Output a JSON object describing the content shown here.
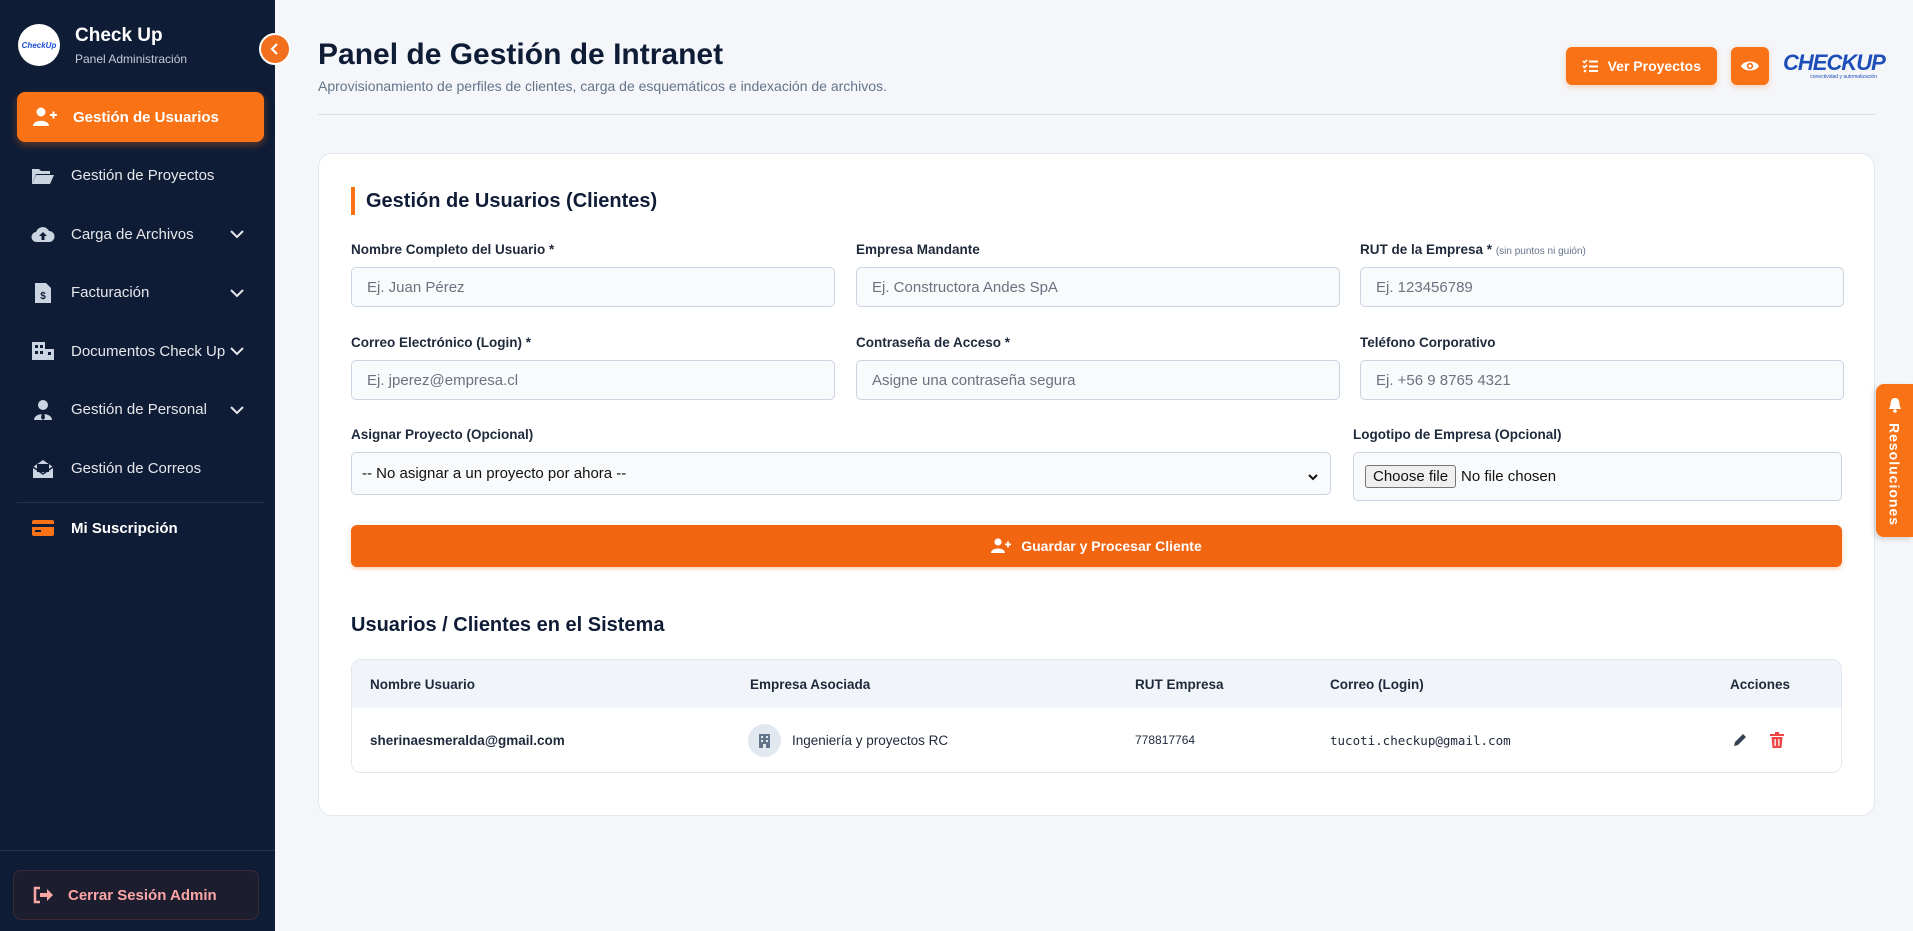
{
  "sidebar": {
    "brand_title": "Check Up",
    "brand_subtitle": "Panel Administración",
    "brand_logo_text": "CheckUp",
    "items": [
      {
        "label": "Gestión de Usuarios",
        "icon": "user-plus-icon",
        "active": true
      },
      {
        "label": "Gestión de Proyectos",
        "icon": "folder-open-icon"
      },
      {
        "label": "Carga de Archivos",
        "icon": "cloud-upload-icon",
        "expandable": true
      },
      {
        "label": "Facturación",
        "icon": "invoice-icon",
        "expandable": true
      },
      {
        "label": "Documentos Check Up",
        "icon": "building-icon",
        "expandable": true
      },
      {
        "label": "Gestión de Personal",
        "icon": "user-tie-icon",
        "expandable": true
      },
      {
        "label": "Gestión de Correos",
        "icon": "envelope-open-icon"
      },
      {
        "label": "Mi Suscripción",
        "icon": "credit-card-icon"
      }
    ],
    "logout_label": "Cerrar Sesión Admin"
  },
  "header": {
    "title": "Panel de Gestión de Intranet",
    "subtitle": "Aprovisionamiento de perfiles de clientes, carga de esquemáticos e indexación de archivos.",
    "projects_button": "Ver Proyectos",
    "logo_text": "CHECKUP",
    "logo_tagline": "conectividad y automatización"
  },
  "form": {
    "section_title": "Gestión de Usuarios (Clientes)",
    "fields": {
      "name": {
        "label": "Nombre Completo del Usuario *",
        "placeholder": "Ej. Juan Pérez"
      },
      "company": {
        "label": "Empresa Mandante",
        "placeholder": "Ej. Constructora Andes SpA"
      },
      "rut": {
        "label": "RUT de la Empresa *",
        "hint": "(sin puntos ni guión)",
        "placeholder": "Ej. 123456789"
      },
      "email": {
        "label": "Correo Electrónico (Login) *",
        "placeholder": "Ej. jperez@empresa.cl"
      },
      "password": {
        "label": "Contraseña de Acceso *",
        "placeholder": "Asigne una contraseña segura"
      },
      "phone": {
        "label": "Teléfono Corporativo",
        "placeholder": "Ej. +56 9 8765 4321"
      },
      "project": {
        "label": "Asignar Proyecto (Opcional)",
        "selected": "-- No asignar a un proyecto por ahora --"
      },
      "logo": {
        "label": "Logotipo de Empresa (Opcional)",
        "button": "Choose file",
        "status": "No file chosen"
      }
    },
    "submit_label": "Guardar y Procesar Cliente"
  },
  "table": {
    "title": "Usuarios / Clientes en el Sistema",
    "columns": [
      "Nombre Usuario",
      "Empresa Asociada",
      "RUT Empresa",
      "Correo (Login)",
      "Acciones"
    ],
    "rows": [
      {
        "user": "sherinaesmeralda@gmail.com",
        "company": "Ingeniería y proyectos RC",
        "rut": "778817764",
        "email": "tucoti.checkup@gmail.com"
      }
    ]
  },
  "side_tab": {
    "label": "Resoluciones",
    "icon": "bell-icon"
  },
  "colors": {
    "accent": "#f97316",
    "sidebar_bg": "#0f1c36",
    "danger": "#ef4444"
  }
}
